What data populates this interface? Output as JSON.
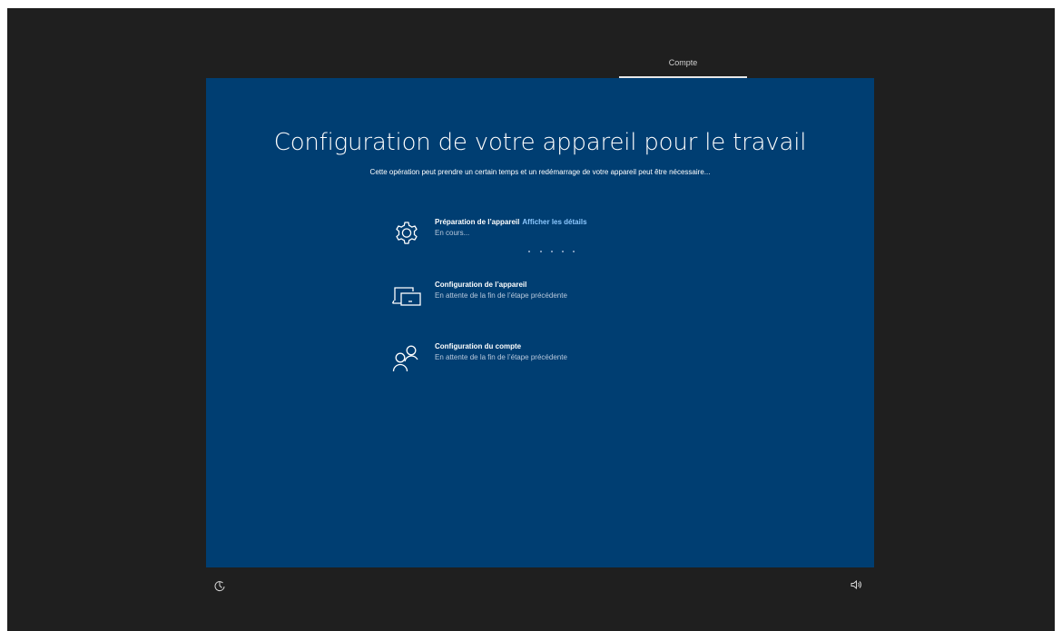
{
  "header": {
    "tab_label": "Compte"
  },
  "main": {
    "title": "Configuration de votre appareil pour le travail",
    "subtitle": "Cette opération peut prendre un certain temps et un redémarrage de votre appareil peut être nécessaire...",
    "steps": [
      {
        "icon": "gear-icon",
        "title": "Préparation de l’appareil",
        "link": "Afficher les détails",
        "status": "En cours..."
      },
      {
        "icon": "device-setup-icon",
        "title": "Configuration de l’appareil",
        "status": "En attente de la fin de l’étape précédente"
      },
      {
        "icon": "account-icon",
        "title": "Configuration du compte",
        "status": "En attente de la fin de l’étape précédente"
      }
    ]
  },
  "footer": {
    "left_icon": "ease-of-access-icon",
    "right_icon": "volume-icon"
  },
  "colors": {
    "background": "#1f1f1f",
    "panel": "#003e72",
    "link": "#8cc8ff",
    "status_text": "#b7c8dc"
  }
}
